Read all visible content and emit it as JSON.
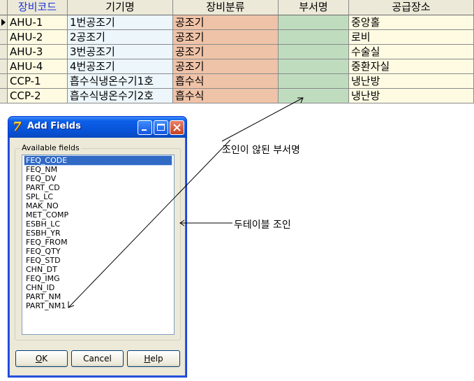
{
  "grid": {
    "columns": [
      "장비코드",
      "기기명",
      "장비분류",
      "부서명",
      "공급장소"
    ],
    "rows": [
      {
        "code": "AHU-1",
        "name": "1번공조기",
        "cls": "공조기",
        "dept": "",
        "sup": "중앙홀"
      },
      {
        "code": "AHU-2",
        "name": "2공조기",
        "cls": "공조기",
        "dept": "",
        "sup": "로비"
      },
      {
        "code": "AHU-3",
        "name": "3번공조기",
        "cls": "공조기",
        "dept": "",
        "sup": "수술실"
      },
      {
        "code": "AHU-4",
        "name": "4번공조기",
        "cls": "공조기",
        "dept": "",
        "sup": "중환자실"
      },
      {
        "code": "CCP-1",
        "name": "흡수식냉온수기1호",
        "cls": "흡수식",
        "dept": "",
        "sup": "냉난방"
      },
      {
        "code": "CCP-2",
        "name": "흡수식냉온수기2호",
        "cls": "흡수식",
        "dept": "",
        "sup": "냉난방"
      }
    ]
  },
  "dialog": {
    "title": "Add Fields",
    "group_label": "Available fields",
    "fields": [
      "FEQ_CODE",
      "FEQ_NM",
      "FEQ_DV",
      "PART_CD",
      "SPL_LC",
      "MAK_NO",
      "MET_COMP",
      "ESBH_LC",
      "ESBH_YR",
      "FEQ_FROM",
      "FEQ_QTY",
      "FEQ_STD",
      "CHN_DT",
      "FEQ_IMG",
      "CHN_ID",
      "PART_NM",
      "PART_NM1"
    ],
    "selected": "FEQ_CODE",
    "buttons": {
      "ok_u": "O",
      "ok_rest": "K",
      "cancel": "Cancel",
      "help_u": "H",
      "help_rest": "elp"
    }
  },
  "annotations": {
    "unjoined_dept": "조인이 않된 부서명",
    "two_table_join": "두테이블 조인"
  },
  "colors": {
    "code_col": "#fffbe3",
    "name_col": "#ecf6fb",
    "class_col": "#efc3a8",
    "dept_col": "#bfdcbf",
    "titlebar": "#0752d6",
    "selection": "#316ac5"
  }
}
